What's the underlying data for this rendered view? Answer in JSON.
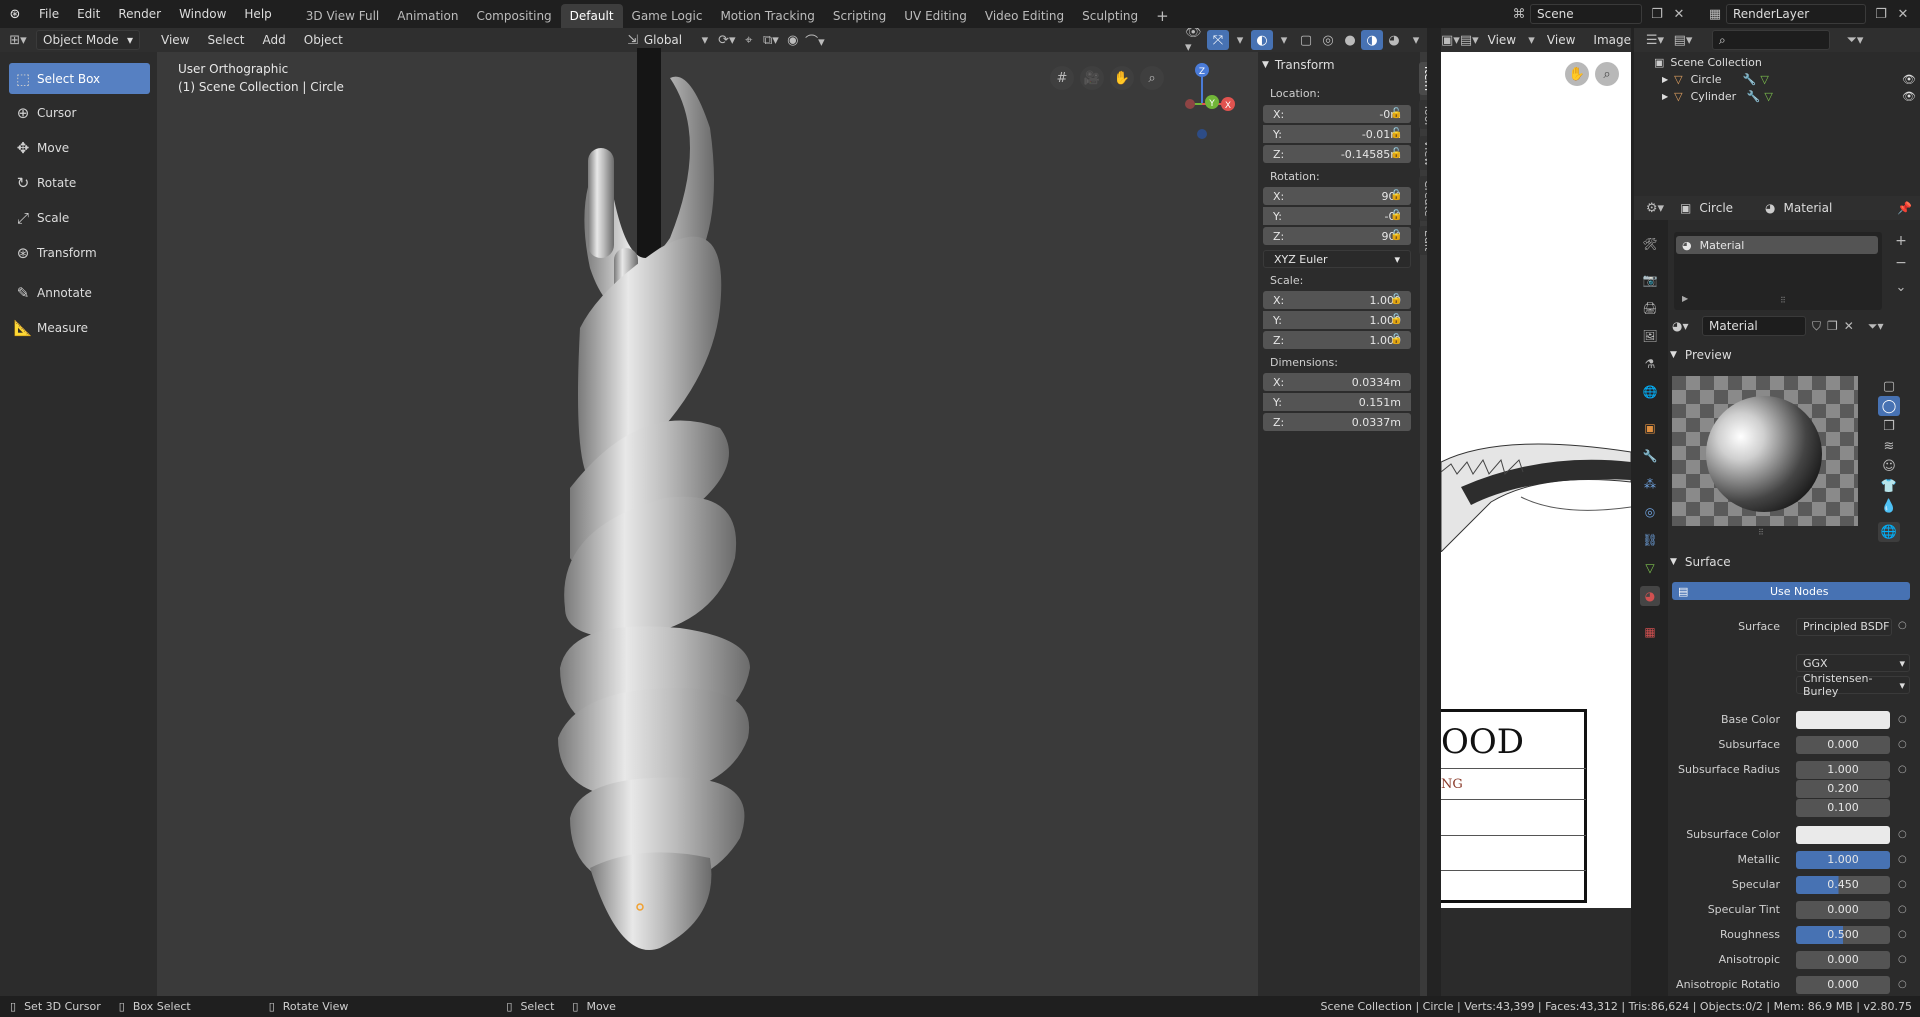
{
  "app": {
    "menus": [
      "File",
      "Edit",
      "Render",
      "Window",
      "Help"
    ],
    "workspaces": [
      "3D View Full",
      "Animation",
      "Compositing",
      "Default",
      "Game Logic",
      "Motion Tracking",
      "Scripting",
      "UV Editing",
      "Video Editing",
      "Sculpting"
    ],
    "active_workspace": "Default",
    "add_workspace": "+",
    "scene": "Scene",
    "render_layer": "RenderLayer"
  },
  "viewport": {
    "mode": "Object Mode",
    "menus": [
      "View",
      "Select",
      "Add",
      "Object"
    ],
    "orientation": "Global",
    "view_name": "User Orthographic",
    "collection_info": "(1) Scene Collection | Circle",
    "gizmo": {
      "x": "X",
      "y": "Y",
      "z": "Z"
    },
    "tools": [
      "Select Box",
      "Cursor",
      "Move",
      "Rotate",
      "Scale",
      "Transform",
      "Annotate",
      "Measure"
    ]
  },
  "npanel": {
    "title": "Transform",
    "location_label": "Location:",
    "location": {
      "x": "-0m",
      "y": "-0.01m",
      "z": "-0.14585m"
    },
    "rotation_label": "Rotation:",
    "rotation": {
      "x": "90°",
      "y": "-0°",
      "z": "90°"
    },
    "rotation_mode": "XYZ Euler",
    "scale_label": "Scale:",
    "scale": {
      "x": "1.000",
      "y": "1.000",
      "z": "1.000"
    },
    "dimensions_label": "Dimensions:",
    "dimensions": {
      "x": "0.0334m",
      "y": "0.151m",
      "z": "0.0337m"
    },
    "axis": {
      "x": "X:",
      "y": "Y:",
      "z": "Z:"
    },
    "tabs": [
      "Item",
      "Tool",
      "View",
      "Create",
      "Edit"
    ]
  },
  "image_editor": {
    "menus": [
      "View",
      "View",
      "Image"
    ],
    "doc_title": "OOD",
    "doc_sub": "NG"
  },
  "outliner": {
    "root": "Scene Collection",
    "items": [
      "Circle",
      "Cylinder"
    ]
  },
  "properties": {
    "object": "Circle",
    "material": "Material",
    "slot": "Material",
    "datablock": "Material",
    "preview": "Preview",
    "surface_section": "Surface",
    "use_nodes": "Use Nodes",
    "surface_label": "Surface",
    "surface_shader": "Principled BSDF",
    "distribution": "GGX",
    "subsurface_method": "Christensen-Burley",
    "rows": [
      {
        "label": "Base Color",
        "value": "",
        "type": "color"
      },
      {
        "label": "Subsurface",
        "value": "0.000",
        "type": "num"
      },
      {
        "label": "Subsurface Radius",
        "value": "1.000",
        "type": "num"
      },
      {
        "label": "",
        "value": "0.200",
        "type": "num"
      },
      {
        "label": "",
        "value": "0.100",
        "type": "num"
      },
      {
        "label": "Subsurface Color",
        "value": "",
        "type": "color"
      },
      {
        "label": "Metallic",
        "value": "1.000",
        "type": "slider",
        "fill": 1.0
      },
      {
        "label": "Specular",
        "value": "0.450",
        "type": "slider",
        "fill": 0.45
      },
      {
        "label": "Specular Tint",
        "value": "0.000",
        "type": "num"
      },
      {
        "label": "Roughness",
        "value": "0.500",
        "type": "slider",
        "fill": 0.5
      },
      {
        "label": "Anisotropic",
        "value": "0.000",
        "type": "num"
      },
      {
        "label": "Anisotropic Rotatio",
        "value": "0.000",
        "type": "num"
      }
    ]
  },
  "statusbar": {
    "items": [
      "Set 3D Cursor",
      "Box Select",
      "Rotate View",
      "Select",
      "Move"
    ],
    "stats": "Scene Collection | Circle | Verts:43,399 | Faces:43,312 | Tris:86,624 | Objects:0/2 | Mem: 86.9 MB | v2.80.75"
  },
  "colors": {
    "accent": "#4772b3",
    "active_tool": "#5680c2",
    "bg": "#232323"
  }
}
